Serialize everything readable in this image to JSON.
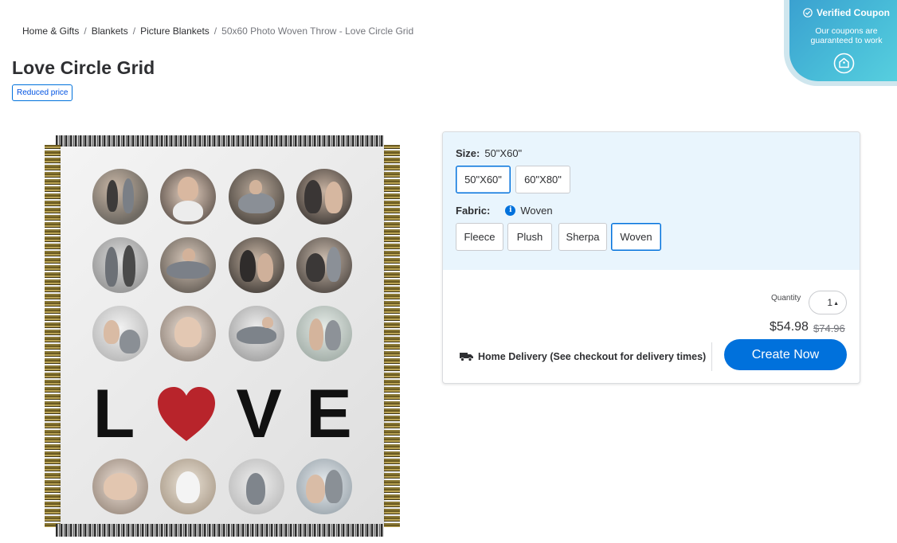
{
  "breadcrumb": {
    "items": [
      "Home & Gifts",
      "Blankets",
      "Picture Blankets"
    ],
    "separator": "/",
    "current": "50x60 Photo Woven Throw - Love Circle Grid"
  },
  "product": {
    "title": "Love Circle Grid",
    "badge": "Reduced price"
  },
  "blanket_art": {
    "letters": [
      "L",
      "V",
      "E"
    ],
    "heart_color": "#b8242b"
  },
  "options": {
    "size": {
      "label": "Size:",
      "selected": "50\"X60\"",
      "choices": [
        "50\"X60\"",
        "60\"X80\""
      ]
    },
    "fabric": {
      "label": "Fabric:",
      "selected": "Woven",
      "choices": [
        "Fleece",
        "Plush",
        "Sherpa",
        "Woven"
      ]
    }
  },
  "purchase": {
    "quantity_label": "Quantity",
    "quantity": "1",
    "price": "$54.98",
    "was_price": "$74.96",
    "delivery_text": "Home Delivery (See checkout for delivery times)",
    "cta_label": "Create Now"
  },
  "coupon": {
    "title": "Verified Coupon",
    "subtitle": "Our coupons are guaranteed to work"
  },
  "colors": {
    "accent": "#0071dc",
    "options_bg": "#e9f5fd",
    "coupon_gradient_start": "#3aa0d0",
    "coupon_gradient_end": "#58d0df"
  }
}
